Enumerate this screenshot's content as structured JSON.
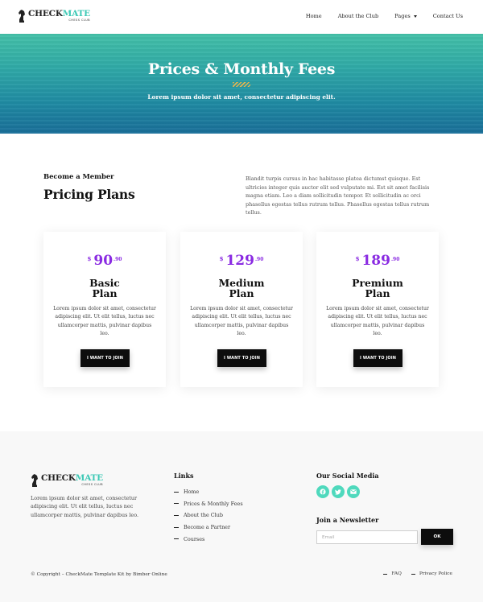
{
  "header": {
    "logo": {
      "brand_part1": "CHECK",
      "brand_part2": "MATE",
      "tagline": "CHESS CLUB"
    },
    "nav": [
      {
        "label": "Home"
      },
      {
        "label": "About the Club"
      },
      {
        "label": "Pages",
        "dropdown": true
      },
      {
        "label": "Contact Us"
      }
    ]
  },
  "hero": {
    "title": "Prices & Monthly Fees",
    "subtitle": "Lorem ipsum dolor sit amet, consectetur adipiscing elit."
  },
  "intro": {
    "eyebrow": "Become a Member",
    "title": "Pricing Plans",
    "text": "Blandit turpis cursus in hac habitasse platea dictumst quisque. Est ultricies integer quis auctor elit sed vulputate mi. Est sit amet facilisis magna etiam. Leo a diam sollicitudin tempor. Et sollicitudin ac orci phasellus egestas tellus rutrum tellus. Phasellus egestas tellus rutrum tellus."
  },
  "plans": [
    {
      "currency": "$",
      "amount": "90",
      "cents": ".90",
      "name_line1": "Basic",
      "name_line2": "Plan",
      "description": "Lorem ipsum dolor sit amet, consectetur adipiscing elit. Ut elit tellus, luctus nec ullamcorper mattis, pulvinar dapibus leo.",
      "button": "I WANT TO JOIN"
    },
    {
      "currency": "$",
      "amount": "129",
      "cents": ".90",
      "name_line1": "Medium",
      "name_line2": "Plan",
      "description": "Lorem ipsum dolor sit amet, consectetur adipiscing elit. Ut elit tellus, luctus nec ullamcorper mattis, pulvinar dapibus leo.",
      "button": "I WANT TO JOIN"
    },
    {
      "currency": "$",
      "amount": "189",
      "cents": ".90",
      "name_line1": "Premium",
      "name_line2": "Plan",
      "description": "Lorem ipsum dolor sit amet, consectetur adipiscing elit. Ut elit tellus, luctus nec ullamcorper mattis, pulvinar dapibus leo.",
      "button": "I WANT TO JOIN"
    }
  ],
  "footer": {
    "about": "Lorem ipsum dolor sit amet, consectetur adipiscing elit. Ut elit tellus, luctus nec ullamcorper mattis, pulvinar dapibus leo.",
    "links_title": "Links",
    "links": [
      "Home",
      "Prices & Monthly Fees",
      "About the Club",
      "Become a Partner",
      "Courses"
    ],
    "social_title": "Our Social Media",
    "social_icons": [
      "facebook-icon",
      "twitter-icon",
      "email-icon"
    ],
    "newsletter_title": "Join a Newsletter",
    "email_placeholder": "Email",
    "ok_label": "OK",
    "copyright": "© Copyright – CheckMate Template Kit by Bimber Online",
    "bottom_links": [
      "FAQ",
      "Privacy Police"
    ]
  },
  "colors": {
    "accent": "#8a2be2",
    "brand_teal": "#3ec9b6",
    "social_bg": "#4fd9bd",
    "button": "#0d0d0d",
    "stripes": "#e1b350"
  }
}
